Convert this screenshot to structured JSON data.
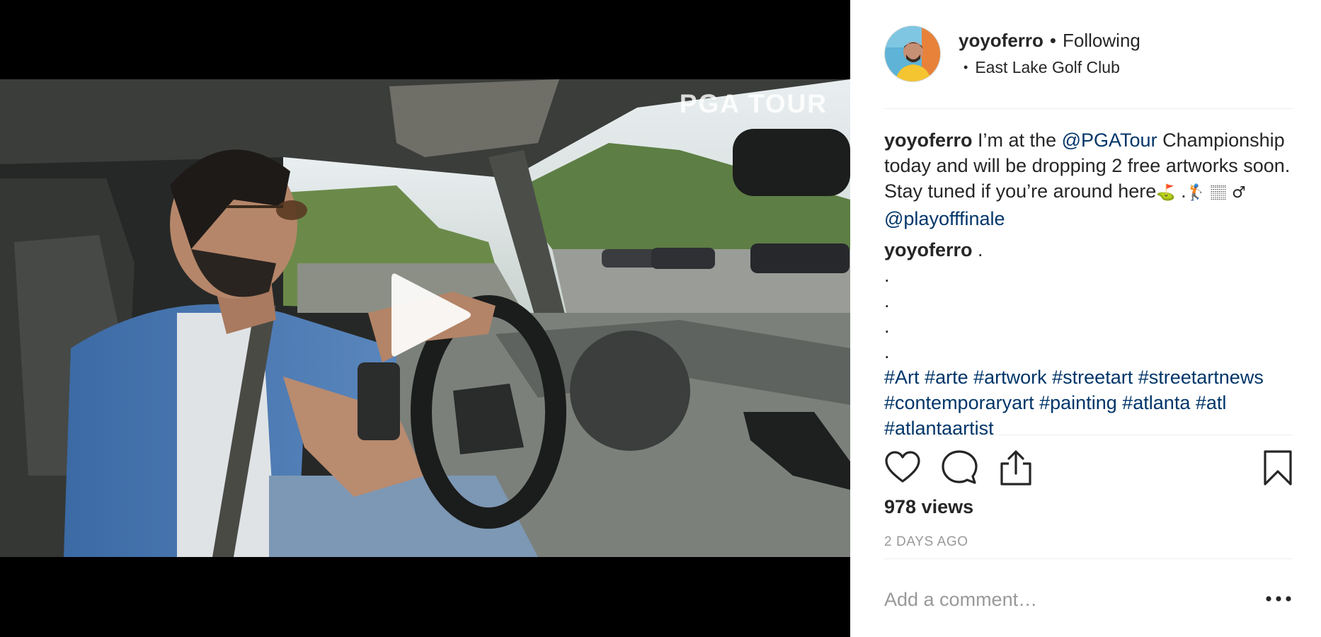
{
  "video": {
    "watermark": "PGA TOUR"
  },
  "post": {
    "author": {
      "username": "yoyoferro",
      "follow_state": "Following",
      "location": "East Lake Golf Club"
    },
    "caption": {
      "username": "yoyoferro",
      "text_before_mention": " I’m at the ",
      "mention_1": "@PGATour",
      "text_after_mention": " Championship today and will be dropping 2 free artworks soon. Stay tuned if you’re around here",
      "emoji_golf": "⛳",
      "text_dot": "  .",
      "emoji_golfer": "🏌",
      "emoji_tone": "🏽",
      "emoji_male": "♂",
      "mention_2": "@playofffinale"
    },
    "second_caption": {
      "username": "yoyoferro",
      "text": " .",
      "dots": [
        ".",
        ".",
        ".",
        "."
      ],
      "hashtags": [
        "#Art",
        "#arte",
        "#artwork",
        "#streetart",
        "#streetartnews",
        "#contemporaryart",
        "#painting",
        "#atlanta",
        "#atl",
        "#atlantaartist"
      ]
    },
    "actions": {
      "like": "heart-icon",
      "comment": "comment-icon",
      "share": "share-icon",
      "save": "bookmark-icon"
    },
    "views": "978 views",
    "timestamp": "2 DAYS AGO",
    "comment_placeholder": "Add a comment…",
    "more_label": "•••"
  }
}
